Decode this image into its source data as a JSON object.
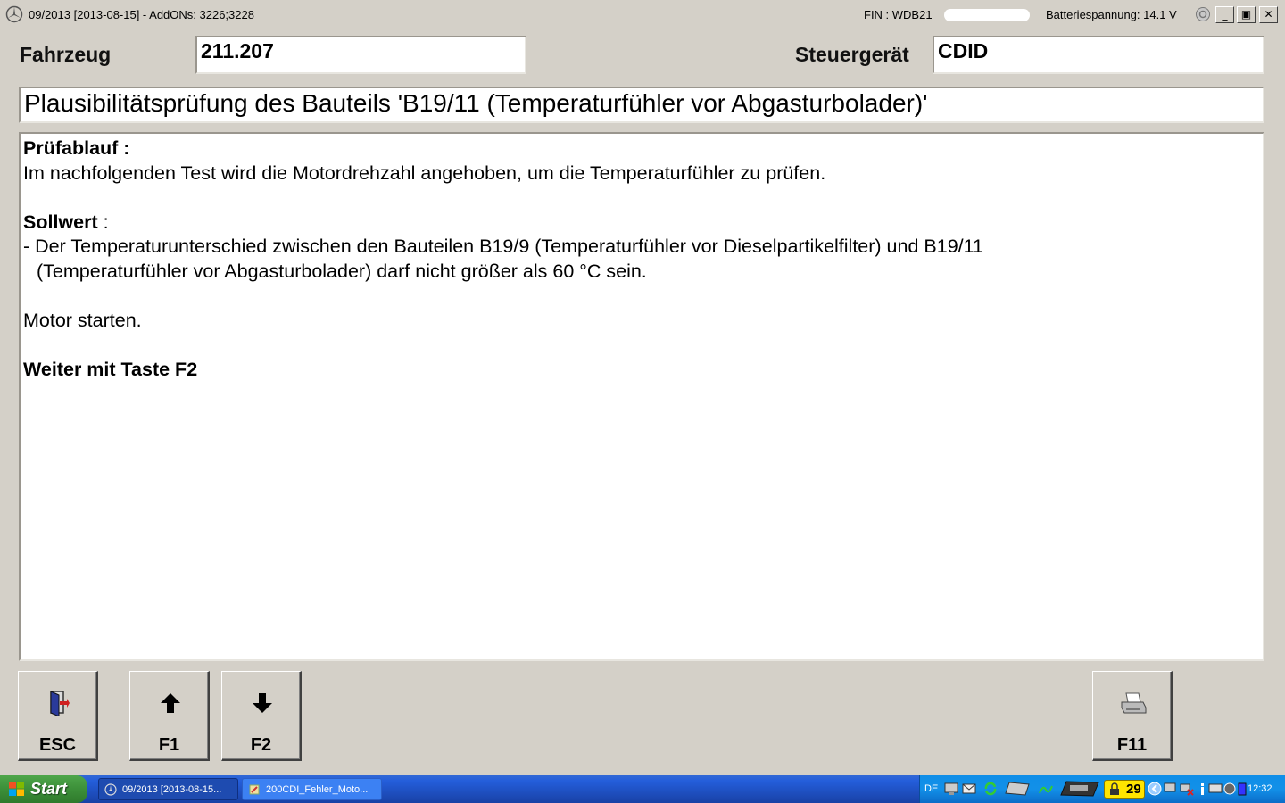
{
  "titlebar": {
    "title": "09/2013 [2013-08-15] - AddONs: 3226;3228",
    "fin": "FIN : WDB21",
    "battery": "Batteriespannung: 14.1 V",
    "minimize": "_",
    "restore": "▣",
    "close": "✕"
  },
  "header": {
    "fahrzeug_label": "Fahrzeug",
    "fahrzeug_value": "211.207",
    "steuergeraet_label": "Steuergerät",
    "steuergeraet_value": "CDID"
  },
  "headline": "Plausibilitätsprüfung des Bauteils 'B19/11 (Temperaturfühler vor Abgasturbolader)'",
  "content": {
    "pruefablauf_heading": "Prüfablauf :",
    "pruefablauf_text": "Im nachfolgenden Test wird die Motordrehzahl angehoben, um die Temperaturfühler zu prüfen.",
    "sollwert_heading": "Sollwert",
    "sollwert_colon": " :",
    "sollwert_line1": "- Der Temperaturunterschied zwischen den Bauteilen B19/9 (Temperaturfühler vor Dieselpartikelfilter) und B19/11",
    "sollwert_line2": "(Temperaturfühler vor Abgasturbolader) darf nicht größer als 60 °C sein.",
    "motor_text": "Motor starten.",
    "weiter_text": "Weiter mit Taste F2"
  },
  "buttons": {
    "esc": "ESC",
    "f1": "F1",
    "f2": "F2",
    "f11": "F11"
  },
  "taskbar": {
    "start": "Start",
    "task1": "09/2013 [2013-08-15...",
    "task2": "200CDI_Fehler_Moto...",
    "lang": "DE",
    "badge": "29",
    "clock": "12:32"
  }
}
